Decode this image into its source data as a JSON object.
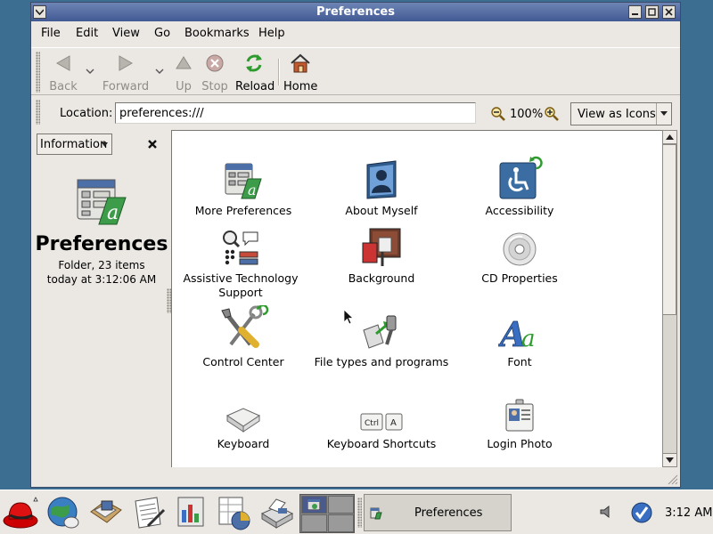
{
  "window": {
    "title": "Preferences"
  },
  "menubar": {
    "items": [
      {
        "label": "File"
      },
      {
        "label": "Edit"
      },
      {
        "label": "View"
      },
      {
        "label": "Go"
      },
      {
        "label": "Bookmarks"
      },
      {
        "label": "Help"
      }
    ]
  },
  "toolbar": {
    "back": {
      "label": "Back",
      "icon": "back-arrow-icon",
      "enabled": false
    },
    "forward": {
      "label": "Forward",
      "icon": "forward-arrow-icon",
      "enabled": false
    },
    "up": {
      "label": "Up",
      "icon": "up-arrow-icon",
      "enabled": false
    },
    "stop": {
      "label": "Stop",
      "icon": "stop-icon",
      "enabled": false
    },
    "reload": {
      "label": "Reload",
      "icon": "reload-icon",
      "enabled": true
    },
    "home": {
      "label": "Home",
      "icon": "home-icon",
      "enabled": true
    }
  },
  "location": {
    "label": "Location:",
    "value": "preferences:///",
    "zoom": "100%",
    "view_as": "View as Icons"
  },
  "sidebar": {
    "selector": "Information",
    "title": "Preferences",
    "info_line1": "Folder, 23 items",
    "info_line2": "today at 3:12:06 AM"
  },
  "content": {
    "items": [
      {
        "label": "More Preferences",
        "icon": "more-preferences-icon"
      },
      {
        "label": "About Myself",
        "icon": "about-myself-icon"
      },
      {
        "label": "Accessibility",
        "icon": "accessibility-icon"
      },
      {
        "label": "Assistive Technology Support",
        "icon": "assistive-technology-icon"
      },
      {
        "label": "Background",
        "icon": "background-icon"
      },
      {
        "label": "CD Properties",
        "icon": "cd-properties-icon"
      },
      {
        "label": "Control Center",
        "icon": "control-center-icon"
      },
      {
        "label": "File types and programs",
        "icon": "file-types-icon"
      },
      {
        "label": "Font",
        "icon": "font-icon"
      },
      {
        "label": "Keyboard",
        "icon": "keyboard-icon"
      },
      {
        "label": "Keyboard Shortcuts",
        "icon": "keyboard-shortcuts-icon"
      },
      {
        "label": "Login Photo",
        "icon": "login-photo-icon"
      }
    ],
    "kbd_keys": [
      "Ctrl",
      "A"
    ]
  },
  "panel": {
    "task_label": "Preferences",
    "clock": "3:12 AM"
  },
  "colors": {
    "titlebar": "#4b64a0",
    "content_bg": "#ffffff",
    "panel_bg": "#ebe8e4",
    "desktop": "#3c6e91"
  }
}
